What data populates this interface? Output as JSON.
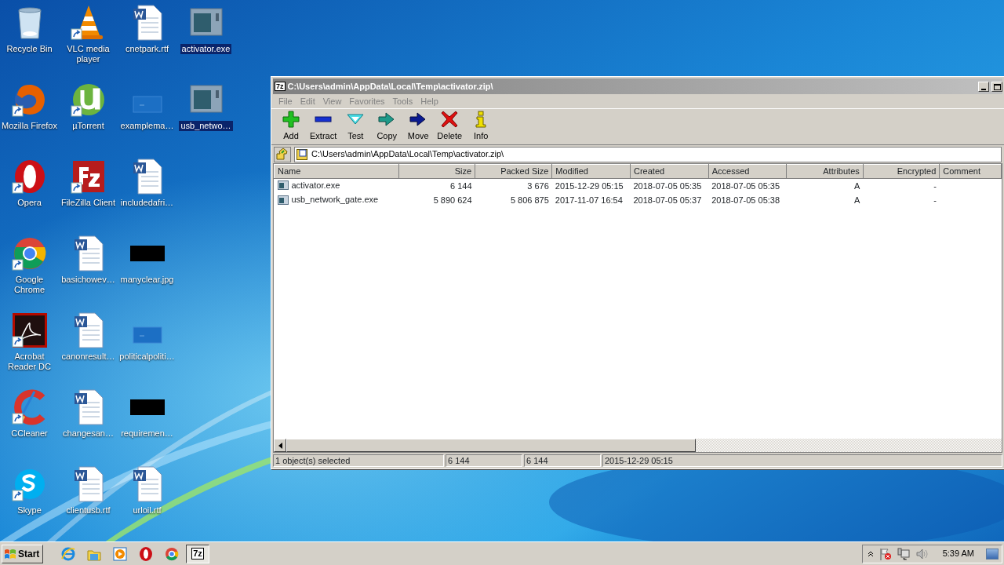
{
  "desktop": {
    "rows": [
      [
        {
          "label": "Recycle Bin",
          "kind": "recycle",
          "shortcut": false,
          "selected": false
        },
        {
          "label": "VLC media player",
          "kind": "vlc",
          "shortcut": true,
          "selected": false
        },
        {
          "label": "cnetpark.rtf",
          "kind": "word",
          "shortcut": false,
          "selected": false
        },
        {
          "label": "activator.exe",
          "kind": "exe",
          "shortcut": false,
          "selected": true
        }
      ],
      [
        {
          "label": "Mozilla Firefox",
          "kind": "firefox",
          "shortcut": true,
          "selected": false
        },
        {
          "label": "µTorrent",
          "kind": "utorrent",
          "shortcut": true,
          "selected": false
        },
        {
          "label": "examplema…",
          "kind": "blank",
          "shortcut": false,
          "selected": false
        },
        {
          "label": "usb_netwo…",
          "kind": "exe",
          "shortcut": false,
          "selected": true
        }
      ],
      [
        {
          "label": "Opera",
          "kind": "opera",
          "shortcut": true,
          "selected": false
        },
        {
          "label": "FileZilla Client",
          "kind": "filezilla",
          "shortcut": true,
          "selected": false
        },
        {
          "label": "includedafri…",
          "kind": "word",
          "shortcut": false,
          "selected": false
        }
      ],
      [
        {
          "label": "Google Chrome",
          "kind": "chrome",
          "shortcut": true,
          "selected": false
        },
        {
          "label": "basichowev…",
          "kind": "word",
          "shortcut": false,
          "selected": false
        },
        {
          "label": "manyclear.jpg",
          "kind": "black",
          "shortcut": false,
          "selected": false
        }
      ],
      [
        {
          "label": "Acrobat Reader DC",
          "kind": "acrobat",
          "shortcut": true,
          "selected": false
        },
        {
          "label": "canonresult…",
          "kind": "word",
          "shortcut": false,
          "selected": false
        },
        {
          "label": "politicalpoliti…",
          "kind": "blank",
          "shortcut": false,
          "selected": false
        }
      ],
      [
        {
          "label": "CCleaner",
          "kind": "ccleaner",
          "shortcut": true,
          "selected": false
        },
        {
          "label": "changesan…",
          "kind": "word",
          "shortcut": false,
          "selected": false
        },
        {
          "label": "requiremen…",
          "kind": "black",
          "shortcut": false,
          "selected": false
        }
      ],
      [
        {
          "label": "Skype",
          "kind": "skype",
          "shortcut": true,
          "selected": false
        },
        {
          "label": "clientusb.rtf",
          "kind": "word",
          "shortcut": false,
          "selected": false
        },
        {
          "label": "urloil.rtf",
          "kind": "word",
          "shortcut": false,
          "selected": false
        }
      ]
    ]
  },
  "window": {
    "app_icon": "7z",
    "title": "C:\\Users\\admin\\AppData\\Local\\Temp\\activator.zip\\",
    "menu": [
      "File",
      "Edit",
      "View",
      "Favorites",
      "Tools",
      "Help"
    ],
    "toolbar": [
      {
        "label": "Add",
        "kind": "add"
      },
      {
        "label": "Extract",
        "kind": "extract"
      },
      {
        "label": "Test",
        "kind": "test"
      },
      {
        "label": "Copy",
        "kind": "copy"
      },
      {
        "label": "Move",
        "kind": "move"
      },
      {
        "label": "Delete",
        "kind": "delete"
      },
      {
        "label": "Info",
        "kind": "info"
      }
    ],
    "address": "C:\\Users\\admin\\AppData\\Local\\Temp\\activator.zip\\",
    "table": {
      "columns": [
        "Name",
        "Size",
        "Packed Size",
        "Modified",
        "Created",
        "Accessed",
        "Attributes",
        "Encrypted",
        "Comment"
      ],
      "rows": [
        [
          "activator.exe",
          "6 144",
          "3 676",
          "2015-12-29 05:15",
          "2018-07-05 05:35",
          "2018-07-05 05:35",
          "A",
          "-"
        ],
        [
          "usb_network_gate.exe",
          "5 890 624",
          "5 806 875",
          "2017-11-07 16:54",
          "2018-07-05 05:37",
          "2018-07-05 05:38",
          "A",
          "-"
        ]
      ]
    },
    "status_bar": [
      "1 object(s) selected",
      "6 144",
      "6 144",
      "2015-12-29 05:15"
    ]
  },
  "taskbar": {
    "start": "Start",
    "items": [
      {
        "kind": "ie",
        "active": false
      },
      {
        "kind": "folder",
        "active": false
      },
      {
        "kind": "media",
        "active": false
      },
      {
        "kind": "opera",
        "active": false
      },
      {
        "kind": "chrome",
        "active": false
      },
      {
        "kind": "sevenzip",
        "label": "7z",
        "active": true
      }
    ],
    "time": "5:39 AM"
  }
}
